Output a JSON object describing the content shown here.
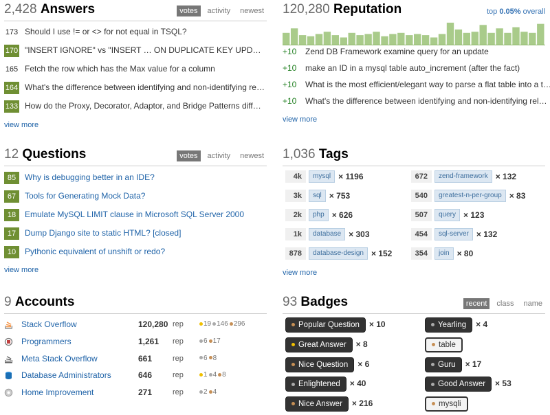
{
  "answers": {
    "count": "2,428",
    "title": "Answers",
    "tabs": [
      "votes",
      "activity",
      "newest"
    ],
    "items": [
      {
        "score": "173",
        "accepted": false,
        "title": "Should I use != or <> for not equal in TSQL?"
      },
      {
        "score": "170",
        "accepted": true,
        "title": "\"INSERT IGNORE\" vs \"INSERT … ON DUPLICATE KEY UPD…"
      },
      {
        "score": "165",
        "accepted": false,
        "title": "Fetch the row which has the Max value for a column"
      },
      {
        "score": "164",
        "accepted": true,
        "title": "What's the difference between identifying and non-identifying re…"
      },
      {
        "score": "133",
        "accepted": true,
        "title": "How do the Proxy, Decorator, Adaptor, and Bridge Patterns diff…"
      }
    ],
    "view_more": "view more"
  },
  "reputation": {
    "count": "120,280",
    "title": "Reputation",
    "top_prefix": "top",
    "top_value": "0.05%",
    "top_suffix": "overall",
    "bars": [
      0.55,
      0.75,
      0.45,
      0.4,
      0.5,
      0.6,
      0.45,
      0.35,
      0.55,
      0.45,
      0.5,
      0.6,
      0.4,
      0.5,
      0.55,
      0.45,
      0.5,
      0.45,
      0.35,
      0.5,
      1.0,
      0.7,
      0.55,
      0.6,
      0.9,
      0.55,
      0.75,
      0.55,
      0.8,
      0.6,
      0.55,
      0.95
    ],
    "items": [
      {
        "points": "+10",
        "title": "Zend DB Framework examine query for an update"
      },
      {
        "points": "+10",
        "title": "make an ID in a mysql table auto_increment (after the fact)"
      },
      {
        "points": "+10",
        "title": "What is the most efficient/elegant way to parse a flat table into a t…"
      },
      {
        "points": "+10",
        "title": "What's the difference between identifying and non-identifying rel…"
      }
    ],
    "view_more": "view more"
  },
  "questions": {
    "count": "12",
    "title": "Questions",
    "tabs": [
      "votes",
      "activity",
      "newest"
    ],
    "items": [
      {
        "score": "85",
        "title": "Why is debugging better in an IDE?"
      },
      {
        "score": "67",
        "title": "Tools for Generating Mock Data?"
      },
      {
        "score": "18",
        "title": "Emulate MySQL LIMIT clause in Microsoft SQL Server 2000"
      },
      {
        "score": "17",
        "title": "Dump Django site to static HTML? [closed]"
      },
      {
        "score": "10",
        "title": "Pythonic equivalent of unshift or redo?"
      }
    ],
    "view_more": "view more"
  },
  "tags": {
    "count": "1,036",
    "title": "Tags",
    "left": [
      {
        "score": "4k",
        "tag": "mysql",
        "posts": "× 1196"
      },
      {
        "score": "3k",
        "tag": "sql",
        "posts": "× 753"
      },
      {
        "score": "2k",
        "tag": "php",
        "posts": "× 626"
      },
      {
        "score": "1k",
        "tag": "database",
        "posts": "× 303"
      },
      {
        "score": "878",
        "tag": "database-design",
        "posts": "× 152"
      }
    ],
    "right": [
      {
        "score": "672",
        "tag": "zend-framework",
        "posts": "× 132"
      },
      {
        "score": "540",
        "tag": "greatest-n-per-group",
        "posts": "× 83"
      },
      {
        "score": "507",
        "tag": "query",
        "posts": "× 123"
      },
      {
        "score": "454",
        "tag": "sql-server",
        "posts": "× 132"
      },
      {
        "score": "354",
        "tag": "join",
        "posts": "× 80"
      }
    ],
    "view_more": "view more"
  },
  "accounts": {
    "count": "9",
    "title": "Accounts",
    "rep_label": "rep",
    "items": [
      {
        "icon": "stackoverflow-icon",
        "name": "Stack Overflow",
        "rep": "120,280",
        "gold": "19",
        "silver": "146",
        "bronze": "296"
      },
      {
        "icon": "programmers-icon",
        "name": "Programmers",
        "rep": "1,261",
        "gold": "",
        "silver": "6",
        "bronze": "17"
      },
      {
        "icon": "meta-stackoverflow-icon",
        "name": "Meta Stack Overflow",
        "rep": "661",
        "gold": "",
        "silver": "6",
        "bronze": "8"
      },
      {
        "icon": "dba-icon",
        "name": "Database Administrators",
        "rep": "646",
        "gold": "1",
        "silver": "4",
        "bronze": "8"
      },
      {
        "icon": "home-improvement-icon",
        "name": "Home Improvement",
        "rep": "271",
        "gold": "",
        "silver": "2",
        "bronze": "4"
      }
    ]
  },
  "badges": {
    "count": "93",
    "title": "Badges",
    "tabs": [
      "recent",
      "class",
      "name"
    ],
    "left": [
      {
        "name": "Popular Question",
        "class": "bronze",
        "count": "× 10",
        "tag_based": false
      },
      {
        "name": "Great Answer",
        "class": "gold",
        "count": "× 8",
        "tag_based": false
      },
      {
        "name": "Nice Question",
        "class": "bronze",
        "count": "× 6",
        "tag_based": false
      },
      {
        "name": "Enlightened",
        "class": "silver",
        "count": "× 40",
        "tag_based": false
      },
      {
        "name": "Nice Answer",
        "class": "bronze",
        "count": "× 216",
        "tag_based": false
      }
    ],
    "right": [
      {
        "name": "Yearling",
        "class": "silver",
        "count": "× 4",
        "tag_based": false
      },
      {
        "name": "table",
        "class": "bronze",
        "count": "",
        "tag_based": true
      },
      {
        "name": "Guru",
        "class": "silver",
        "count": "× 17",
        "tag_based": false
      },
      {
        "name": "Good Answer",
        "class": "silver",
        "count": "× 53",
        "tag_based": false
      },
      {
        "name": "mysqli",
        "class": "bronze",
        "count": "",
        "tag_based": true
      }
    ]
  }
}
